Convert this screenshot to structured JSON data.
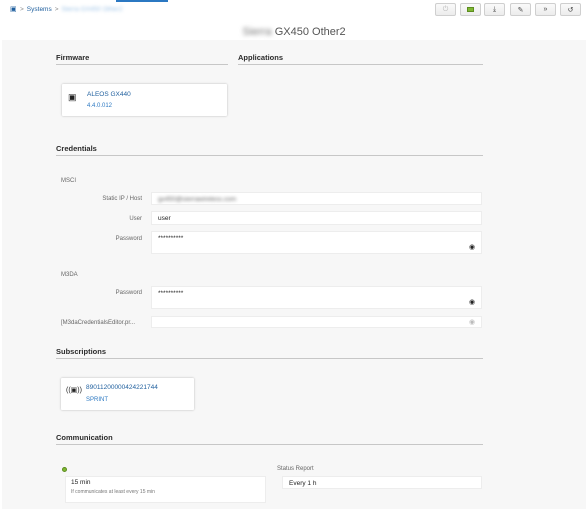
{
  "breadcrumb": {
    "home_icon": "home-icon",
    "separator": ">",
    "systems": "Systems",
    "current": "Sierra GX450 Other2"
  },
  "toolbar": {
    "buttons": [
      {
        "name": "power",
        "icon": "power-icon",
        "glyph": "⏻"
      },
      {
        "name": "chip",
        "icon": "chip-icon",
        "glyph": ""
      },
      {
        "name": "download",
        "icon": "download-icon",
        "glyph": "⤓"
      },
      {
        "name": "edit",
        "icon": "pencil-icon",
        "glyph": "✎"
      },
      {
        "name": "forward",
        "icon": "forward-icon",
        "glyph": "»"
      },
      {
        "name": "refresh",
        "icon": "refresh-icon",
        "glyph": "↺"
      }
    ]
  },
  "page": {
    "title_prefix": "Sierra",
    "title": "GX450 Other2"
  },
  "firmware": {
    "heading": "Firmware",
    "name": "ALEOS GX440",
    "version": "4.4.0.012"
  },
  "applications": {
    "heading": "Applications"
  },
  "credentials": {
    "heading": "Credentials",
    "msci_label": "MSCI",
    "static_ip_label": "Static IP / Host",
    "static_ip_value": "gx450@sierrawireless.com",
    "user_label": "User",
    "user_value": "user",
    "password_label": "Password",
    "password_value": "**********",
    "m3da_label": "M3DA",
    "m3da_password_label": "Password",
    "m3da_password_value": "**********",
    "m3da_editor_label": "[M3daCredentialsEditor.pr..."
  },
  "subscriptions": {
    "heading": "Subscriptions",
    "iccid": "89011200000424221744",
    "operator": "SPRINT"
  },
  "communication": {
    "heading": "Communication",
    "interval_value": "15 min",
    "interval_hint": "If communicates at least every 15 min",
    "status_report_label": "Status Report",
    "status_report_value": "Every 1 h"
  },
  "colors": {
    "accent": "#2b78c2",
    "link": "#1f5f9e",
    "ok_green": "#7fb833"
  }
}
